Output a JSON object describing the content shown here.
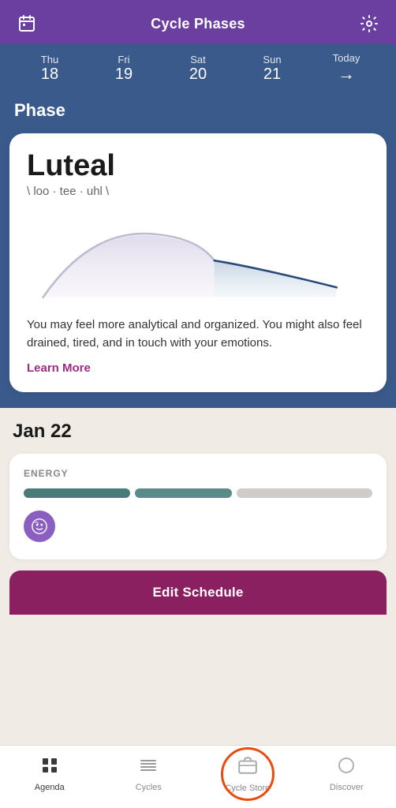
{
  "header": {
    "title": "Cycle Phases",
    "calendar_icon": "📅",
    "settings_icon": "⚙️"
  },
  "date_nav": {
    "days": [
      {
        "name": "Thu",
        "num": "18"
      },
      {
        "name": "Fri",
        "num": "19"
      },
      {
        "name": "Sat",
        "num": "20"
      },
      {
        "name": "Sun",
        "num": "21"
      }
    ],
    "today_label": "Today",
    "today_arrow": "→"
  },
  "phase_section": {
    "label": "Phase"
  },
  "phase_card": {
    "name": "Luteal",
    "pronunciation": "\\ loo · tee · uhl \\",
    "description": "You may feel more analytical and organized. You might also feel drained, tired, and in touch with your emotions.",
    "learn_more": "Learn More"
  },
  "main": {
    "date_heading": "Jan 22",
    "energy_label": "ENERGY",
    "edit_schedule_btn": "Edit Schedule"
  },
  "bottom_nav": {
    "items": [
      {
        "id": "agenda",
        "icon": "▦",
        "label": "Agenda",
        "active": true
      },
      {
        "id": "cycles",
        "icon": "≡",
        "label": "Cycles",
        "active": false
      },
      {
        "id": "cycle-store",
        "icon": "🏪",
        "label": "Cycle Store",
        "active": false
      },
      {
        "id": "discover",
        "icon": "○",
        "label": "Discover",
        "active": false
      }
    ]
  }
}
